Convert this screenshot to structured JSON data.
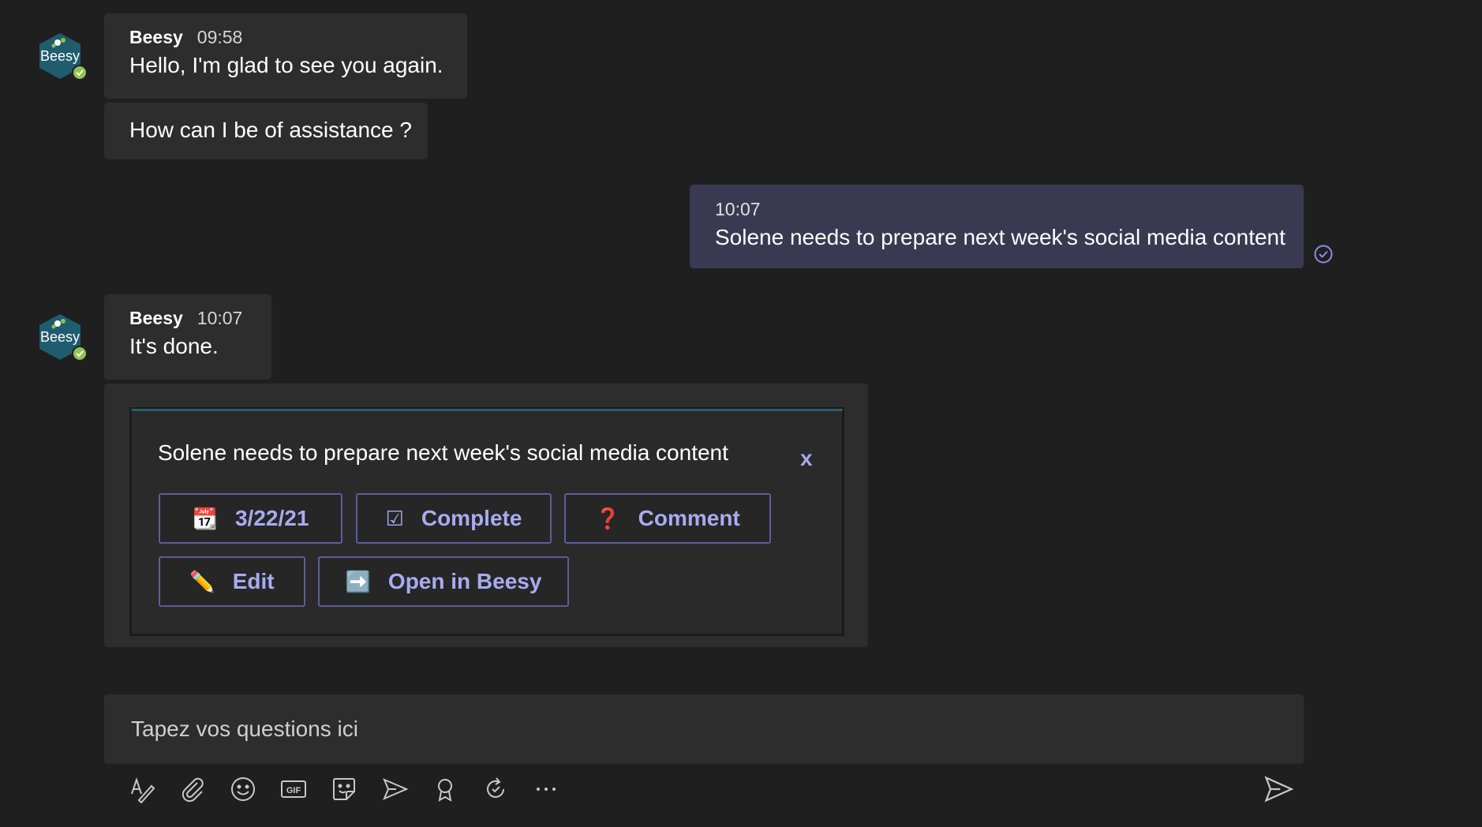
{
  "messages": [
    {
      "sender": "Beesy",
      "time": "09:58",
      "text": "Hello, I'm glad to see you again.",
      "followup": "How can I be of assistance ?"
    },
    {
      "time": "10:07",
      "text": "Solene needs to prepare next week's social media content"
    },
    {
      "sender": "Beesy",
      "time": "10:07",
      "text": "It's done."
    }
  ],
  "avatar": {
    "label": "Beesy",
    "icon": "beesy-logo-icon",
    "status_icon": "available-check-icon"
  },
  "card": {
    "title": "Solene needs to prepare next week's social media content",
    "close_label": "x",
    "actions": [
      {
        "label": "3/22/21",
        "icon": "calendar-icon",
        "glyph": "📆"
      },
      {
        "label": "Complete",
        "icon": "checkbox-icon",
        "glyph": "☑"
      },
      {
        "label": "Comment",
        "icon": "question-mark-icon",
        "glyph": "❓"
      },
      {
        "label": "Edit",
        "icon": "pencil-icon",
        "glyph": "✏️"
      },
      {
        "label": "Open in Beesy",
        "icon": "right-arrow-icon",
        "glyph": "➡️"
      }
    ]
  },
  "compose": {
    "placeholder": "Tapez vos questions ici"
  },
  "toolbar": [
    "format-icon",
    "attach-icon",
    "emoji-icon",
    "gif-icon",
    "sticker-icon",
    "meet-icon",
    "praise-icon",
    "loop-icon",
    "more-options-icon"
  ],
  "colors": {
    "background": "#1f1f1f",
    "bubble": "#2d2d2d",
    "my_bubble": "#393a52",
    "accent": "#a9abf2",
    "card_border": "#5b5e9a"
  }
}
